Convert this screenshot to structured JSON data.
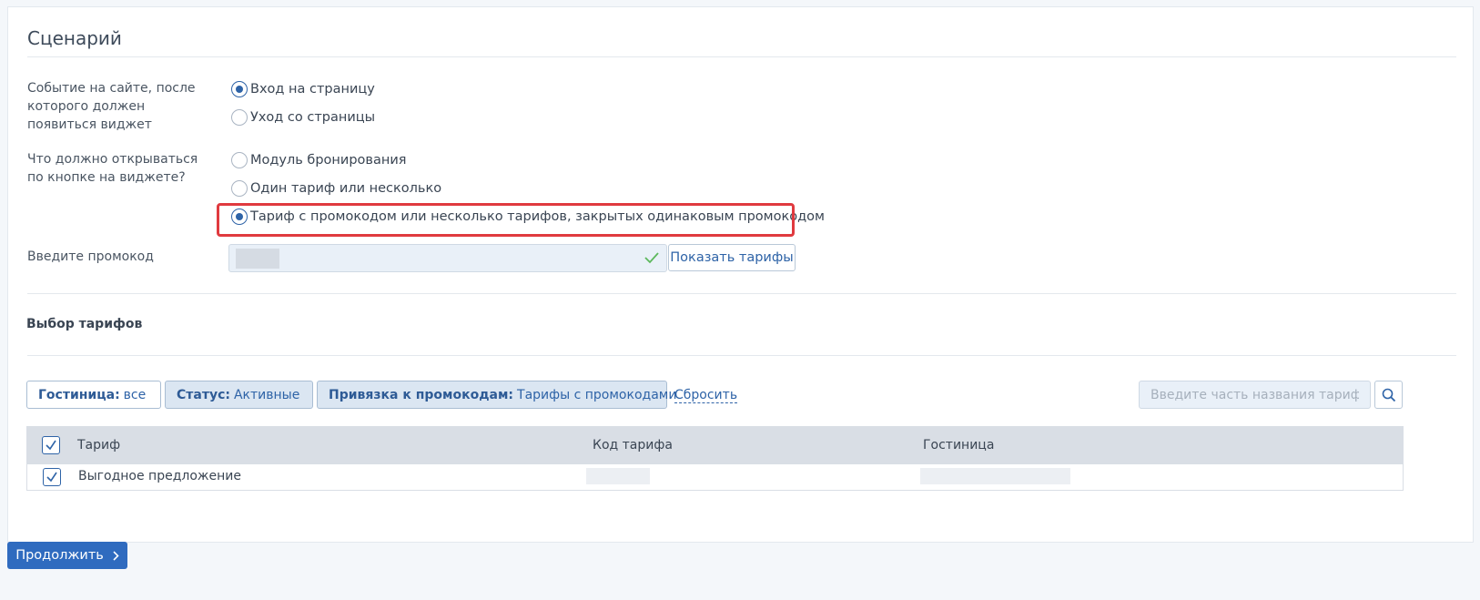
{
  "page": {
    "title": "Сценарий"
  },
  "event": {
    "label": "Событие на сайте, после которого должен появиться виджет",
    "options": [
      {
        "label": "Вход на страницу",
        "selected": true
      },
      {
        "label": "Уход со страницы",
        "selected": false
      }
    ]
  },
  "open": {
    "label": "Что должно открываться по кнопке на виджете?",
    "options": [
      {
        "label": "Модуль бронирования",
        "selected": false
      },
      {
        "label": "Один тариф или несколько",
        "selected": false
      },
      {
        "label": "Тариф с промокодом или несколько тарифов, закрытых одинаковым промокодом",
        "selected": true
      }
    ]
  },
  "promo": {
    "label": "Введите промокод",
    "value": "",
    "show_button": "Показать тарифы"
  },
  "rates": {
    "title": "Выбор тарифов",
    "filters": [
      {
        "key": "Гостиница:",
        "value": "все"
      },
      {
        "key": "Статус:",
        "value": "Активные"
      },
      {
        "key": "Привязка к промокодам:",
        "value": "Тарифы с промокодами"
      }
    ],
    "reset": "Сбросить",
    "search_placeholder": "Введите часть названия тарифа",
    "columns": [
      "Тариф",
      "Код тарифа",
      "Гостиница"
    ],
    "rows": [
      {
        "name": "Выгодное предложение",
        "code": "",
        "hotel": "",
        "checked": true
      }
    ]
  },
  "footer": {
    "continue": "Продолжить"
  },
  "colors": {
    "accent": "#2e63a7",
    "primary_button": "#2f6bbf",
    "highlight": "#e03a3f",
    "check_green": "#5cb85c"
  }
}
